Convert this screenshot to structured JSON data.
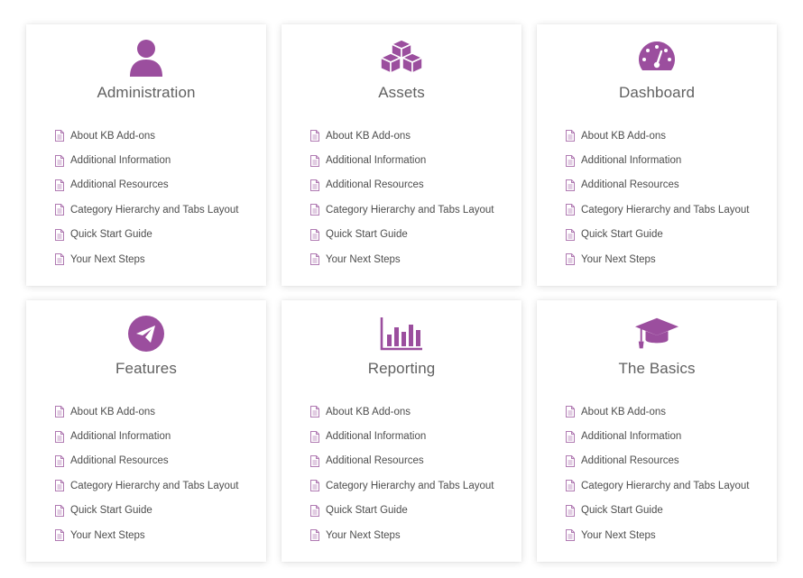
{
  "colors": {
    "accent": "#9b4e9e",
    "title": "#616161",
    "link": "#4d4d4d"
  },
  "categories": [
    {
      "title": "Administration",
      "icon": "user-icon",
      "articles": [
        "About KB Add-ons",
        "Additional Information",
        "Additional Resources",
        "Category Hierarchy and Tabs Layout",
        "Quick Start Guide",
        "Your Next Steps"
      ]
    },
    {
      "title": "Assets",
      "icon": "cubes-icon",
      "articles": [
        "About KB Add-ons",
        "Additional Information",
        "Additional Resources",
        "Category Hierarchy and Tabs Layout",
        "Quick Start Guide",
        "Your Next Steps"
      ]
    },
    {
      "title": "Dashboard",
      "icon": "dashboard-gauge-icon",
      "articles": [
        "About KB Add-ons",
        "Additional Information",
        "Additional Resources",
        "Category Hierarchy and Tabs Layout",
        "Quick Start Guide",
        "Your Next Steps"
      ]
    },
    {
      "title": "Features",
      "icon": "paper-plane-icon",
      "articles": [
        "About KB Add-ons",
        "Additional Information",
        "Additional Resources",
        "Category Hierarchy and Tabs Layout",
        "Quick Start Guide",
        "Your Next Steps"
      ]
    },
    {
      "title": "Reporting",
      "icon": "bar-chart-icon",
      "articles": [
        "About KB Add-ons",
        "Additional Information",
        "Additional Resources",
        "Category Hierarchy and Tabs Layout",
        "Quick Start Guide",
        "Your Next Steps"
      ]
    },
    {
      "title": "The Basics",
      "icon": "graduation-cap-icon",
      "articles": [
        "About KB Add-ons",
        "Additional Information",
        "Additional Resources",
        "Category Hierarchy and Tabs Layout",
        "Quick Start Guide",
        "Your Next Steps"
      ]
    }
  ]
}
